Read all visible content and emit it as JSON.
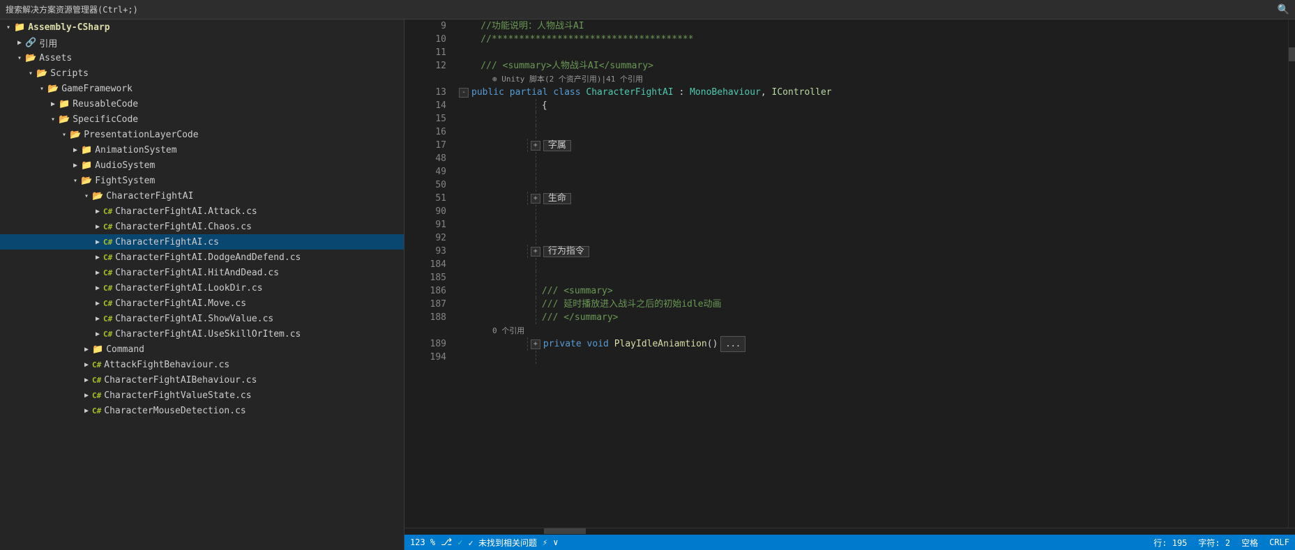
{
  "topbar": {
    "title": "搜索解决方案资源管理器(Ctrl+;)",
    "search_icon": "🔍"
  },
  "sidebar": {
    "items": [
      {
        "id": "assembly",
        "label": "Assembly-CSharp",
        "level": 1,
        "type": "project",
        "expanded": true,
        "arrow": "▾"
      },
      {
        "id": "ref",
        "label": "引用",
        "level": 2,
        "type": "folder",
        "expanded": false,
        "arrow": "▶"
      },
      {
        "id": "assets",
        "label": "Assets",
        "level": 2,
        "type": "folder",
        "expanded": true,
        "arrow": "▾"
      },
      {
        "id": "scripts",
        "label": "Scripts",
        "level": 3,
        "type": "folder",
        "expanded": true,
        "arrow": "▾"
      },
      {
        "id": "gameframework",
        "label": "GameFramework",
        "level": 4,
        "type": "folder",
        "expanded": true,
        "arrow": "▾"
      },
      {
        "id": "reusablecode",
        "label": "ReusableCode",
        "level": 5,
        "type": "folder",
        "expanded": false,
        "arrow": "▶"
      },
      {
        "id": "specificcode",
        "label": "SpecificCode",
        "level": 5,
        "type": "folder",
        "expanded": true,
        "arrow": "▾"
      },
      {
        "id": "presentationlayercode",
        "label": "PresentationLayerCode",
        "level": 6,
        "type": "folder",
        "expanded": true,
        "arrow": "▾"
      },
      {
        "id": "animationsystem",
        "label": "AnimationSystem",
        "level": 7,
        "type": "folder",
        "expanded": false,
        "arrow": "▶"
      },
      {
        "id": "audiosystem",
        "label": "AudioSystem",
        "level": 7,
        "type": "folder",
        "expanded": false,
        "arrow": "▶"
      },
      {
        "id": "fightsystem",
        "label": "FightSystem",
        "level": 7,
        "type": "folder",
        "expanded": true,
        "arrow": "▾"
      },
      {
        "id": "characterfightai",
        "label": "CharacterFightAI",
        "level": 8,
        "type": "folder",
        "expanded": true,
        "arrow": "▾"
      },
      {
        "id": "attack",
        "label": "CharacterFightAI.Attack.cs",
        "level": 9,
        "type": "cs",
        "arrow": "▶"
      },
      {
        "id": "chaos",
        "label": "CharacterFightAI.Chaos.cs",
        "level": 9,
        "type": "cs",
        "arrow": "▶"
      },
      {
        "id": "main",
        "label": "CharacterFightAI.cs",
        "level": 9,
        "type": "cs",
        "arrow": "▶",
        "selected": true
      },
      {
        "id": "dodge",
        "label": "CharacterFightAI.DodgeAndDefend.cs",
        "level": 9,
        "type": "cs",
        "arrow": "▶"
      },
      {
        "id": "hitanddead",
        "label": "CharacterFightAI.HitAndDead.cs",
        "level": 9,
        "type": "cs",
        "arrow": "▶"
      },
      {
        "id": "lookdir",
        "label": "CharacterFightAI.LookDir.cs",
        "level": 9,
        "type": "cs",
        "arrow": "▶"
      },
      {
        "id": "move",
        "label": "CharacterFightAI.Move.cs",
        "level": 9,
        "type": "cs",
        "arrow": "▶"
      },
      {
        "id": "showvalue",
        "label": "CharacterFightAI.ShowValue.cs",
        "level": 9,
        "type": "cs",
        "arrow": "▶"
      },
      {
        "id": "useskill",
        "label": "CharacterFightAI.UseSkillOrItem.cs",
        "level": 9,
        "type": "cs",
        "arrow": "▶"
      },
      {
        "id": "command",
        "label": "Command",
        "level": 8,
        "type": "folder",
        "expanded": false,
        "arrow": "▶"
      },
      {
        "id": "attackbehaviour",
        "label": "AttackFightBehaviour.cs",
        "level": 8,
        "type": "cs",
        "arrow": "▶"
      },
      {
        "id": "characterbehaviour",
        "label": "CharacterFightAIBehaviour.cs",
        "level": 8,
        "type": "cs",
        "arrow": "▶"
      },
      {
        "id": "charactervalue",
        "label": "CharacterFightValueState.cs",
        "level": 8,
        "type": "cs",
        "arrow": "▶"
      },
      {
        "id": "charactermouse",
        "label": "CharacterMouseDetection.cs",
        "level": 8,
        "type": "cs",
        "arrow": "▶"
      }
    ]
  },
  "code": {
    "lines": [
      {
        "num": "9",
        "content_type": "comment",
        "text": "    //功能说明：人物战斗AI"
      },
      {
        "num": "10",
        "content_type": "comment",
        "text": "    //*************************************"
      },
      {
        "num": "11",
        "content_type": "empty",
        "text": ""
      },
      {
        "num": "12",
        "content_type": "comment_summary",
        "text": "    /// <summary>人物战斗AI</summary>"
      },
      {
        "num": "12b",
        "content_type": "ref_info",
        "text": "⊕ Unity 脚本(2 个资产引用)|41 个引用"
      },
      {
        "num": "13",
        "content_type": "class_decl",
        "text": ""
      },
      {
        "num": "14",
        "content_type": "brace",
        "text": "    {"
      },
      {
        "num": "15",
        "content_type": "empty",
        "text": ""
      },
      {
        "num": "16",
        "content_type": "empty",
        "text": ""
      },
      {
        "num": "17",
        "content_type": "region",
        "text": "字属"
      },
      {
        "num": "48",
        "content_type": "empty",
        "text": ""
      },
      {
        "num": "49",
        "content_type": "empty",
        "text": ""
      },
      {
        "num": "50",
        "content_type": "empty",
        "text": ""
      },
      {
        "num": "51",
        "content_type": "region",
        "text": "生命"
      },
      {
        "num": "90",
        "content_type": "empty",
        "text": ""
      },
      {
        "num": "91",
        "content_type": "empty",
        "text": ""
      },
      {
        "num": "92",
        "content_type": "empty",
        "text": ""
      },
      {
        "num": "93",
        "content_type": "region",
        "text": "行为指令"
      },
      {
        "num": "184",
        "content_type": "empty",
        "text": ""
      },
      {
        "num": "185",
        "content_type": "empty",
        "text": ""
      },
      {
        "num": "186",
        "content_type": "comment",
        "text": "    /// <summary>"
      },
      {
        "num": "187",
        "content_type": "comment",
        "text": "    /// 延时播放进入战斗之后的初始idle动画"
      },
      {
        "num": "188",
        "content_type": "comment",
        "text": "    /// </summary>"
      },
      {
        "num": "188b",
        "content_type": "ref_info2",
        "text": "0 个引用"
      },
      {
        "num": "189",
        "content_type": "method",
        "text": ""
      },
      {
        "num": "194",
        "content_type": "empty",
        "text": ""
      }
    ]
  },
  "status": {
    "zoom": "123 %",
    "git_icon": "⎇",
    "status_ok": "✓ 未找到相关问题",
    "arrow_icon": "⚡",
    "dropdown": "∨",
    "row": "行: 195",
    "col": "字符: 2",
    "space": "空格",
    "encoding": "CRLF"
  }
}
